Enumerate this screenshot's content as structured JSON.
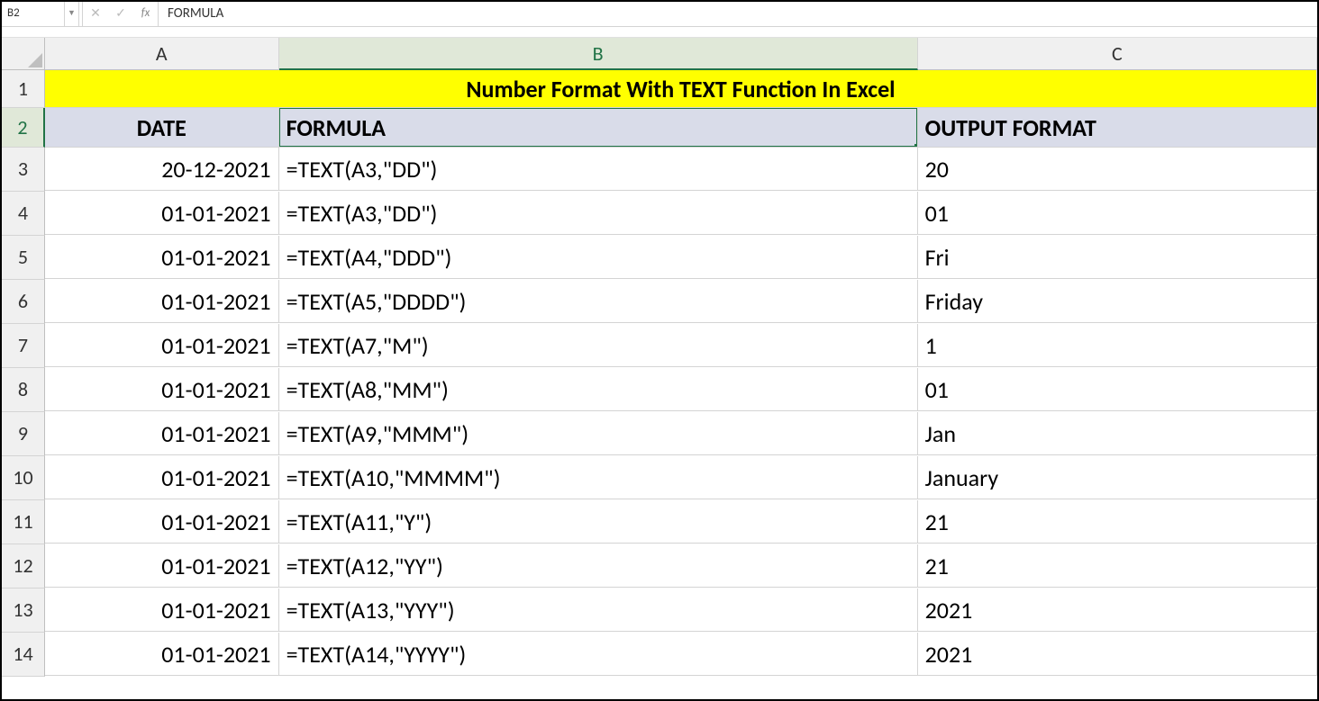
{
  "formulaBar": {
    "nameBox": "B2",
    "formula": "FORMULA"
  },
  "columns": [
    "A",
    "B",
    "C"
  ],
  "title": "Number Format With TEXT Function In Excel",
  "headers": {
    "A": "DATE",
    "B": "FORMULA",
    "C": "OUTPUT FORMAT"
  },
  "selected": {
    "col": "B",
    "row": 2
  },
  "rows": [
    {
      "num": 3,
      "A": "20-12-2021",
      "B": "=TEXT(A3,\"DD\")",
      "C": "20"
    },
    {
      "num": 4,
      "A": "01-01-2021",
      "B": "=TEXT(A3,\"DD\")",
      "C": "01"
    },
    {
      "num": 5,
      "A": "01-01-2021",
      "B": "=TEXT(A4,\"DDD\")",
      "C": "Fri"
    },
    {
      "num": 6,
      "A": "01-01-2021",
      "B": "=TEXT(A5,\"DDDD\")",
      "C": "Friday"
    },
    {
      "num": 7,
      "A": "01-01-2021",
      "B": "=TEXT(A7,\"M\")",
      "C": "1"
    },
    {
      "num": 8,
      "A": "01-01-2021",
      "B": "=TEXT(A8,\"MM\")",
      "C": "01"
    },
    {
      "num": 9,
      "A": "01-01-2021",
      "B": "=TEXT(A9,\"MMM\")",
      "C": "Jan"
    },
    {
      "num": 10,
      "A": "01-01-2021",
      "B": "=TEXT(A10,\"MMMM\")",
      "C": "January"
    },
    {
      "num": 11,
      "A": "01-01-2021",
      "B": "=TEXT(A11,\"Y\")",
      "C": "21"
    },
    {
      "num": 12,
      "A": "01-01-2021",
      "B": "=TEXT(A12,\"YY\")",
      "C": "21"
    },
    {
      "num": 13,
      "A": "01-01-2021",
      "B": "=TEXT(A13,\"YYY\")",
      "C": "2021"
    },
    {
      "num": 14,
      "A": "01-01-2021",
      "B": "=TEXT(A14,\"YYYY\")",
      "C": "2021"
    }
  ]
}
